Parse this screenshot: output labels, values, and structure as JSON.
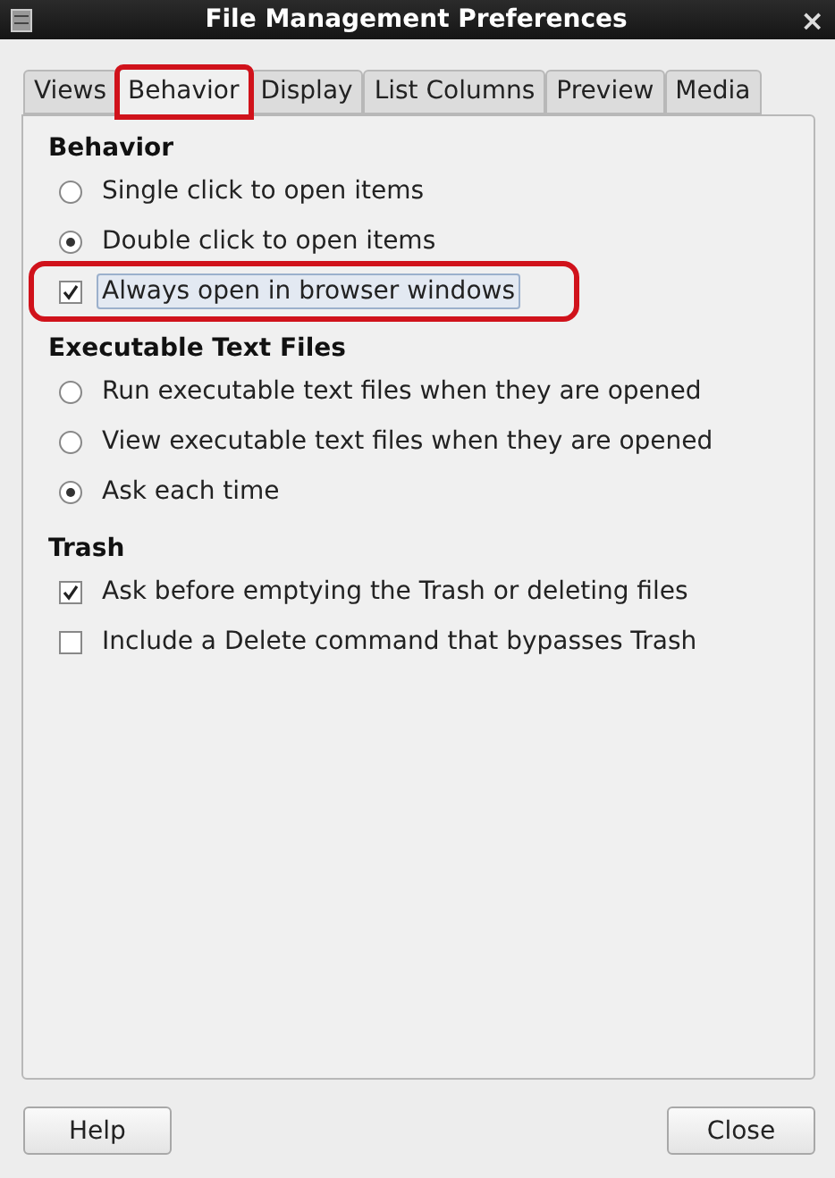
{
  "window": {
    "title": "File Management Preferences",
    "close": "×"
  },
  "tabs": [
    {
      "label": "Views",
      "selected": false,
      "highlighted": false
    },
    {
      "label": "Behavior",
      "selected": true,
      "highlighted": true
    },
    {
      "label": "Display",
      "selected": false,
      "highlighted": false
    },
    {
      "label": "List Columns",
      "selected": false,
      "highlighted": false
    },
    {
      "label": "Preview",
      "selected": false,
      "highlighted": false
    },
    {
      "label": "Media",
      "selected": false,
      "highlighted": false
    }
  ],
  "sections": [
    {
      "title": "Behavior",
      "options": [
        {
          "kind": "radio",
          "label": "Single click to open items",
          "checked": false,
          "highlighted": false
        },
        {
          "kind": "radio",
          "label": "Double click to open items",
          "checked": true,
          "highlighted": false
        },
        {
          "kind": "checkbox",
          "label": "Always open in browser windows",
          "checked": true,
          "highlighted": true
        }
      ]
    },
    {
      "title": "Executable Text Files",
      "options": [
        {
          "kind": "radio",
          "label": "Run executable text files when they are opened",
          "checked": false,
          "highlighted": false
        },
        {
          "kind": "radio",
          "label": "View executable text files when they are opened",
          "checked": false,
          "highlighted": false
        },
        {
          "kind": "radio",
          "label": "Ask each time",
          "checked": true,
          "highlighted": false
        }
      ]
    },
    {
      "title": "Trash",
      "options": [
        {
          "kind": "checkbox",
          "label": "Ask before emptying the Trash or deleting files",
          "checked": true,
          "highlighted": false
        },
        {
          "kind": "checkbox",
          "label": "Include a Delete command that bypasses Trash",
          "checked": false,
          "highlighted": false
        }
      ]
    }
  ],
  "buttons": [
    {
      "label": "Help"
    },
    {
      "label": "Close"
    }
  ]
}
